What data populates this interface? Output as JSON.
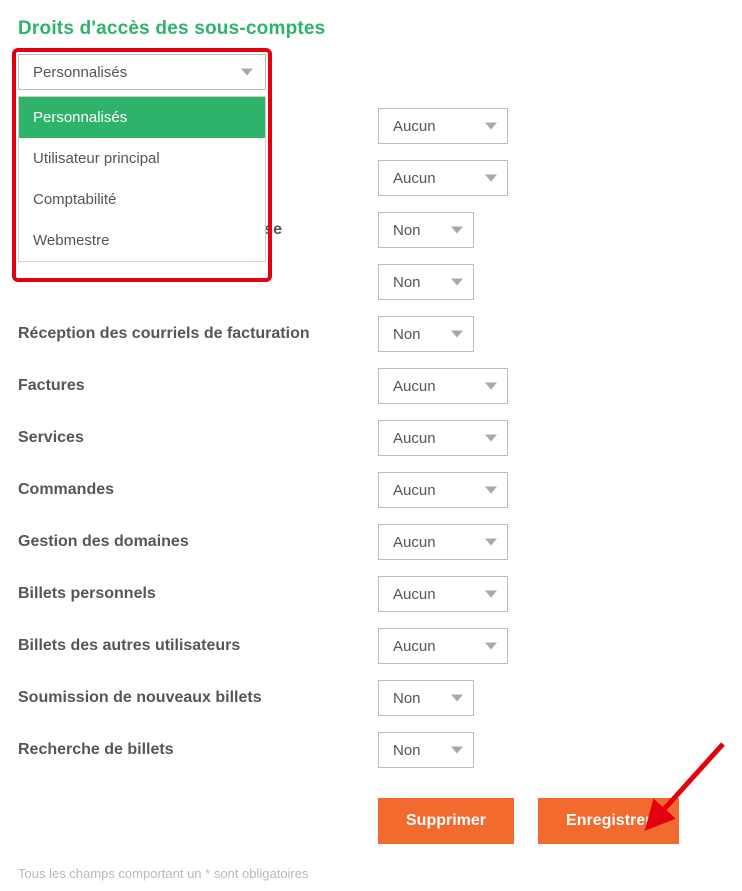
{
  "title": "Droits d'accès des sous-comptes",
  "profile": {
    "selected": "Personnalisés",
    "options": [
      "Personnalisés",
      "Utilisateur principal",
      "Comptabilité",
      "Webmestre"
    ]
  },
  "rows": [
    {
      "label": "",
      "value": "Aucun",
      "size": "wide"
    },
    {
      "label": "",
      "value": "Aucun",
      "size": "wide"
    },
    {
      "label": "se",
      "value": "Non",
      "size": "small"
    },
    {
      "label": "",
      "value": "Non",
      "size": "small"
    },
    {
      "label": "Réception des courriels de facturation",
      "value": "Non",
      "size": "small"
    },
    {
      "label": "Factures",
      "value": "Aucun",
      "size": "wide"
    },
    {
      "label": "Services",
      "value": "Aucun",
      "size": "wide"
    },
    {
      "label": "Commandes",
      "value": "Aucun",
      "size": "wide"
    },
    {
      "label": "Gestion des domaines",
      "value": "Aucun",
      "size": "wide"
    },
    {
      "label": "Billets personnels",
      "value": "Aucun",
      "size": "wide"
    },
    {
      "label": "Billets des autres utilisateurs",
      "value": "Aucun",
      "size": "wide"
    },
    {
      "label": "Soumission de nouveaux billets",
      "value": "Non",
      "size": "small"
    },
    {
      "label": "Recherche de billets",
      "value": "Non",
      "size": "small"
    }
  ],
  "buttons": {
    "delete": "Supprimer",
    "save": "Enregistrer"
  },
  "footer_note": "Tous les champs comportant un * sont obligatoires",
  "colors": {
    "accent_green": "#2fb36a",
    "accent_orange": "#f26a2e",
    "annotation_red": "#e3000f"
  }
}
